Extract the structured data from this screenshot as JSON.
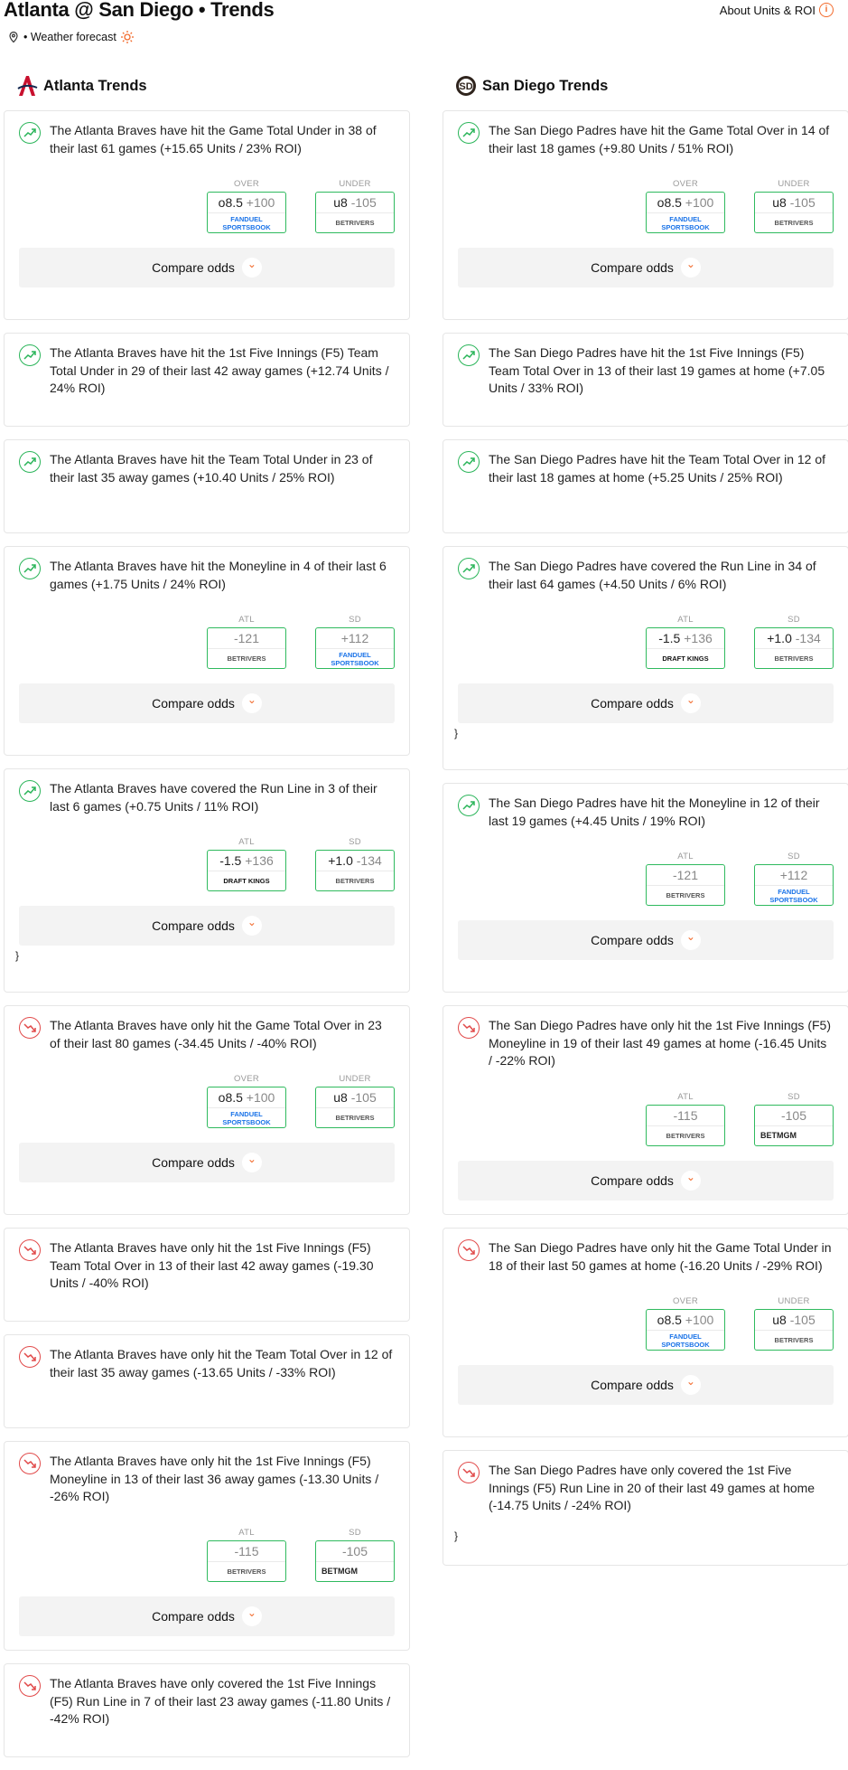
{
  "header": {
    "title": "Atlanta @ San Diego • Trends",
    "about": "About Units & ROI",
    "weather": "• Weather forecast"
  },
  "left": {
    "title": "Atlanta Trends",
    "cards": [
      {
        "dir": "up",
        "text": "The Atlanta Braves have hit the Game Total Under in 38 of their last 61 games (+15.65 Units / 23% ROI)",
        "h": 232,
        "odds": [
          {
            "label": "OVER",
            "main": "o8.5",
            "price": "+100",
            "book": "FANDUEL SPORTSBOOK",
            "bk": "fd"
          },
          {
            "label": "UNDER",
            "main": "u8",
            "price": "-105",
            "book": "BETRIVERS",
            "bk": "br"
          }
        ],
        "compare": "Compare odds"
      },
      {
        "dir": "up",
        "text": "The Atlanta Braves have hit the 1st Five Innings (F5) Team Total Under in 29 of their last 42 away games (+12.74 Units / 24% ROI)",
        "h": 104
      },
      {
        "dir": "up",
        "text": "The Atlanta Braves have hit the Team Total Under in 23 of their last 35 away games (+10.40 Units / 25% ROI)",
        "h": 104
      },
      {
        "dir": "up",
        "text": "The Atlanta Braves have hit the Moneyline in 4 of their last 6 games (+1.75 Units / 24% ROI)",
        "h": 232,
        "odds": [
          {
            "label": "ATL",
            "main": "",
            "price": "-121",
            "book": "BETRIVERS",
            "bk": "br"
          },
          {
            "label": "SD",
            "main": "",
            "price": "+112",
            "book": "FANDUEL SPORTSBOOK",
            "bk": "fd"
          }
        ],
        "compare": "Compare odds"
      },
      {
        "dir": "up",
        "text": "The Atlanta Braves have covered the Run Line in 3 of their last 6 games (+0.75 Units / 11% ROI)",
        "h": 248,
        "odds": [
          {
            "label": "ATL",
            "main": "-1.5",
            "price": "+136",
            "book": "DRAFT KINGS",
            "bk": "dk"
          },
          {
            "label": "SD",
            "main": "+1.0",
            "price": "-134",
            "book": "BETRIVERS",
            "bk": "br"
          }
        ],
        "compare": "Compare odds",
        "brace": "}"
      },
      {
        "dir": "dn",
        "text": "The Atlanta Braves have only hit the Game Total Over in 23 of their last 80 games (-34.45 Units / -40% ROI)",
        "h": 232,
        "odds": [
          {
            "label": "OVER",
            "main": "o8.5",
            "price": "+100",
            "book": "FANDUEL SPORTSBOOK",
            "bk": "fd"
          },
          {
            "label": "UNDER",
            "main": "u8",
            "price": "-105",
            "book": "BETRIVERS",
            "bk": "br"
          }
        ],
        "compare": "Compare odds"
      },
      {
        "dir": "dn",
        "text": "The Atlanta Braves have only hit the 1st Five Innings (F5) Team Total Over in 13 of their last 42 away games (-19.30 Units / -40% ROI)",
        "h": 104
      },
      {
        "dir": "dn",
        "text": "The Atlanta Braves have only hit the Team Total Over in 12 of their last 35 away games (-13.65 Units / -33% ROI)",
        "h": 104
      },
      {
        "dir": "dn",
        "text": "The Atlanta Braves have only hit the 1st Five Innings (F5) Moneyline in 13 of their last 36 away games (-13.30 Units / -26% ROI)",
        "h": 232,
        "odds": [
          {
            "label": "ATL",
            "main": "",
            "price": "-115",
            "book": "BETRIVERS",
            "bk": "br"
          },
          {
            "label": "SD",
            "main": "",
            "price": "-105",
            "book": "BETMGM",
            "bk": "mgm"
          }
        ],
        "compare": "Compare odds"
      },
      {
        "dir": "dn",
        "text": "The Atlanta Braves have only covered the 1st Five Innings (F5) Run Line in 7 of their last 23 away games (-11.80 Units / -42% ROI)",
        "h": 104
      }
    ]
  },
  "right": {
    "title": "San Diego Trends",
    "cards": [
      {
        "dir": "up",
        "text": "The San Diego Padres have hit the Game Total Over in 14 of their last 18 games (+9.80 Units / 51% ROI)",
        "h": 232,
        "odds": [
          {
            "label": "OVER",
            "main": "o8.5",
            "price": "+100",
            "book": "FANDUEL SPORTSBOOK",
            "bk": "fd"
          },
          {
            "label": "UNDER",
            "main": "u8",
            "price": "-105",
            "book": "BETRIVERS",
            "bk": "br"
          }
        ],
        "compare": "Compare odds"
      },
      {
        "dir": "up",
        "text": "The San Diego Padres have hit the 1st Five Innings (F5) Team Total Over in 13 of their last 19 games at home (+7.05 Units / 33% ROI)",
        "h": 104
      },
      {
        "dir": "up",
        "text": "The San Diego Padres have hit the Team Total Over in 12 of their last 18 games at home (+5.25 Units / 25% ROI)",
        "h": 104
      },
      {
        "dir": "up",
        "text": "The San Diego Padres have covered the Run Line in 34 of their last 64 games (+4.50 Units / 6% ROI)",
        "h": 248,
        "odds": [
          {
            "label": "ATL",
            "main": "-1.5",
            "price": "+136",
            "book": "DRAFT KINGS",
            "bk": "dk"
          },
          {
            "label": "SD",
            "main": "+1.0",
            "price": "-134",
            "book": "BETRIVERS",
            "bk": "br"
          }
        ],
        "compare": "Compare odds",
        "brace": "}"
      },
      {
        "dir": "up",
        "text": "The San Diego Padres have hit the Moneyline in 12 of their last 19 games (+4.45 Units / 19% ROI)",
        "h": 232,
        "odds": [
          {
            "label": "ATL",
            "main": "",
            "price": "-121",
            "book": "BETRIVERS",
            "bk": "br"
          },
          {
            "label": "SD",
            "main": "",
            "price": "+112",
            "book": "FANDUEL SPORTSBOOK",
            "bk": "fd"
          }
        ],
        "compare": "Compare odds"
      },
      {
        "dir": "dn",
        "text": "The San Diego Padres have only hit the 1st Five Innings (F5) Moneyline in 19 of their last 49 games at home (-16.45 Units / -22% ROI)",
        "h": 232,
        "odds": [
          {
            "label": "ATL",
            "main": "",
            "price": "-115",
            "book": "BETRIVERS",
            "bk": "br"
          },
          {
            "label": "SD",
            "main": "",
            "price": "-105",
            "book": "BETMGM",
            "bk": "mgm"
          }
        ],
        "compare": "Compare odds"
      },
      {
        "dir": "dn",
        "text": "The San Diego Padres have only hit the Game Total Under in 18 of their last 50 games at home (-16.20 Units / -29% ROI)",
        "h": 232,
        "odds": [
          {
            "label": "OVER",
            "main": "o8.5",
            "price": "+100",
            "book": "FANDUEL SPORTSBOOK",
            "bk": "fd"
          },
          {
            "label": "UNDER",
            "main": "u8",
            "price": "-105",
            "book": "BETRIVERS",
            "bk": "br"
          }
        ],
        "compare": "Compare odds"
      },
      {
        "dir": "dn",
        "text": "The San Diego Padres have only covered the 1st Five Innings (F5) Run Line in 20 of their last 49 games at home (-14.75 Units / -24% ROI)",
        "h": 128,
        "brace": "}"
      }
    ]
  }
}
